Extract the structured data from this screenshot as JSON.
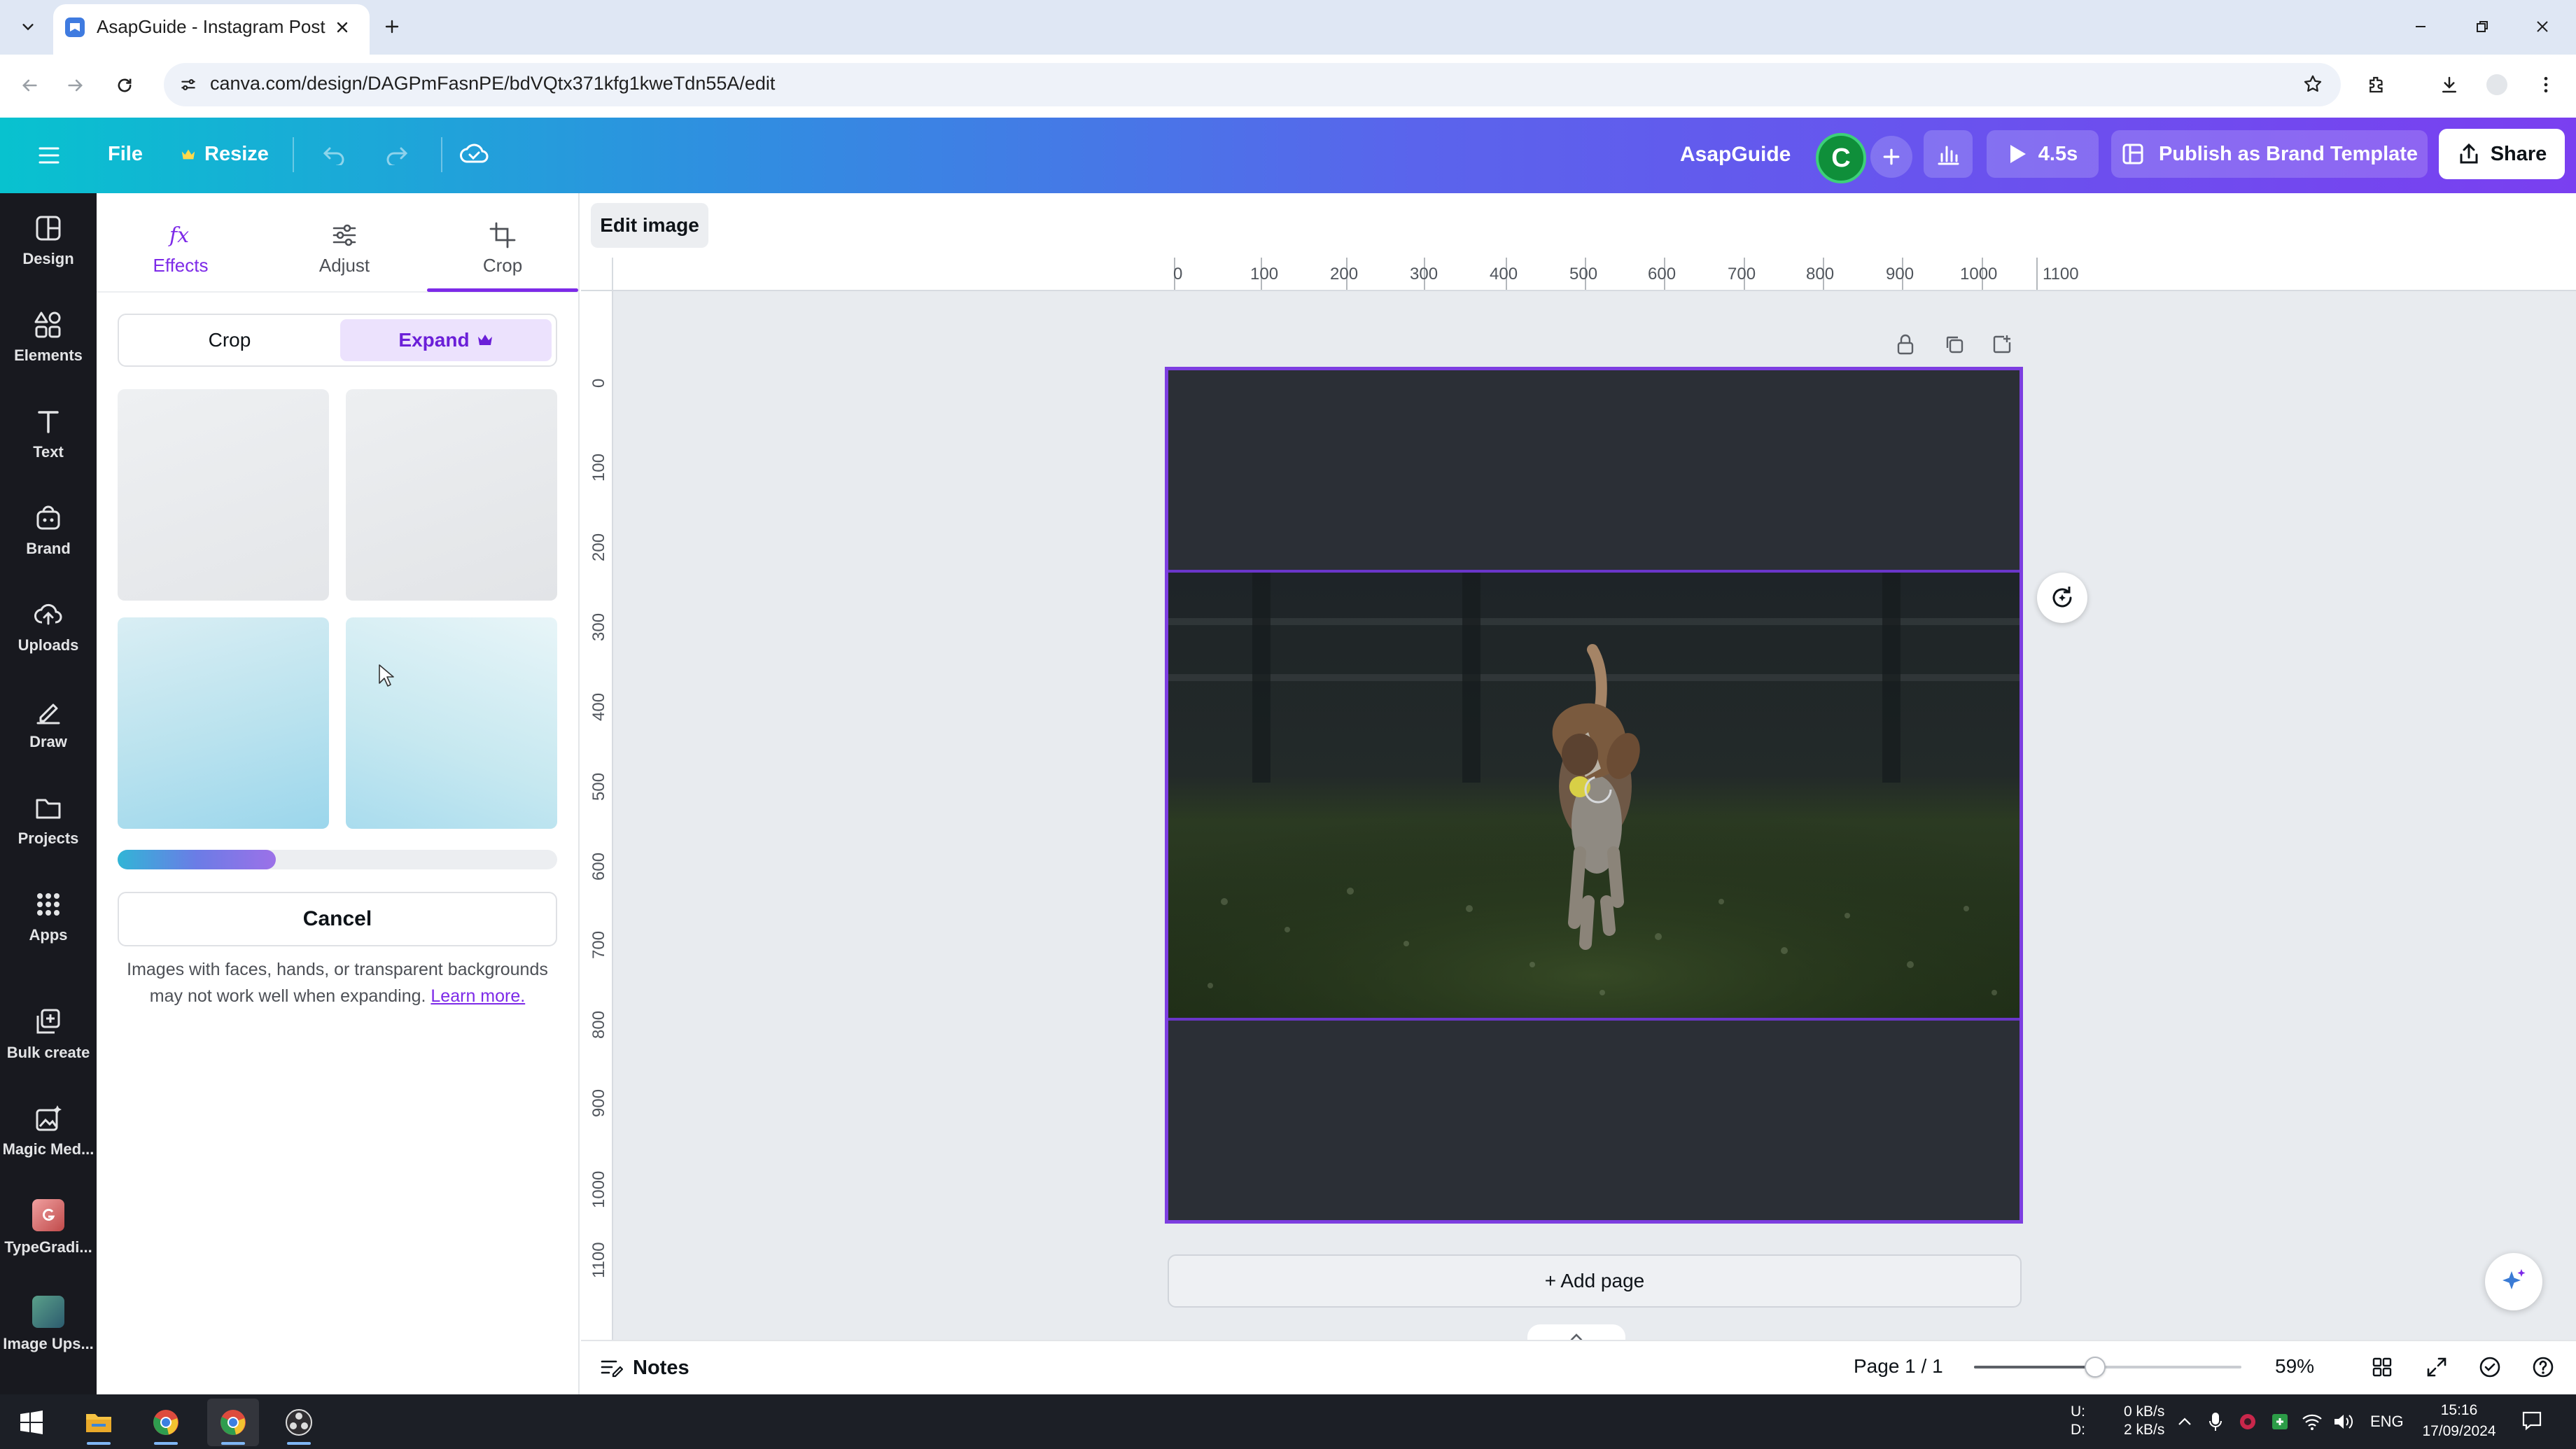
{
  "browser": {
    "tab_title": "AsapGuide - Instagram Post",
    "url": "canva.com/design/DAGPmFasnPE/bdVQtx371kfg1kweTdn55A/edit"
  },
  "header": {
    "file_label": "File",
    "resize_label": "Resize",
    "brand_name": "AsapGuide",
    "avatar_initial": "C",
    "play_duration": "4.5s",
    "publish_label": "Publish as Brand Template",
    "share_label": "Share"
  },
  "rail": {
    "items": [
      {
        "label": "Design",
        "icon": "design-icon"
      },
      {
        "label": "Elements",
        "icon": "elements-icon"
      },
      {
        "label": "Text",
        "icon": "text-icon"
      },
      {
        "label": "Brand",
        "icon": "brand-icon"
      },
      {
        "label": "Uploads",
        "icon": "uploads-icon"
      },
      {
        "label": "Draw",
        "icon": "draw-icon"
      },
      {
        "label": "Projects",
        "icon": "projects-icon"
      },
      {
        "label": "Apps",
        "icon": "apps-icon"
      },
      {
        "label": "Bulk create",
        "icon": "bulk-create-icon"
      },
      {
        "label": "Magic Med...",
        "icon": "magic-media-icon"
      },
      {
        "label": "TypeGradi...",
        "icon": "typegradient-app-icon"
      },
      {
        "label": "Image Ups...",
        "icon": "image-upscaler-app-icon"
      }
    ]
  },
  "panel": {
    "tabs": [
      {
        "label": "Effects",
        "active": false
      },
      {
        "label": "Adjust",
        "active": false
      },
      {
        "label": "Crop",
        "active": true
      }
    ],
    "segment": {
      "crop_label": "Crop",
      "expand_label": "Expand",
      "selected": "Expand"
    },
    "progress": 0.36,
    "cancel_label": "Cancel",
    "notice_text": "Images with faces, hands, or transparent backgrounds may not work well when expanding.",
    "learn_more_label": "Learn more."
  },
  "editor": {
    "edit_image_label": "Edit image",
    "ruler_top": [
      "0",
      "100",
      "200",
      "300",
      "400",
      "500",
      "600",
      "700",
      "800",
      "900",
      "1000",
      "1100"
    ],
    "ruler_left": [
      "0",
      "100",
      "200",
      "300",
      "400",
      "500",
      "600",
      "700",
      "800",
      "900",
      "1000",
      "1100"
    ],
    "add_page_label": "+ Add page"
  },
  "footer": {
    "notes_label": "Notes",
    "page_indicator": "Page 1 / 1",
    "zoom": "59%"
  },
  "taskbar": {
    "net_up_label": "U:",
    "net_down_label": "D:",
    "net_up": "0 kB/s",
    "net_down": "2 kB/s",
    "language": "ENG",
    "time": "15:16",
    "date": "17/09/2024"
  },
  "colors": {
    "accent": "#7d2ae8",
    "header_gradient_start": "#08c2cf",
    "header_gradient_end": "#7a3ff0",
    "rail_bg": "#18191f"
  }
}
